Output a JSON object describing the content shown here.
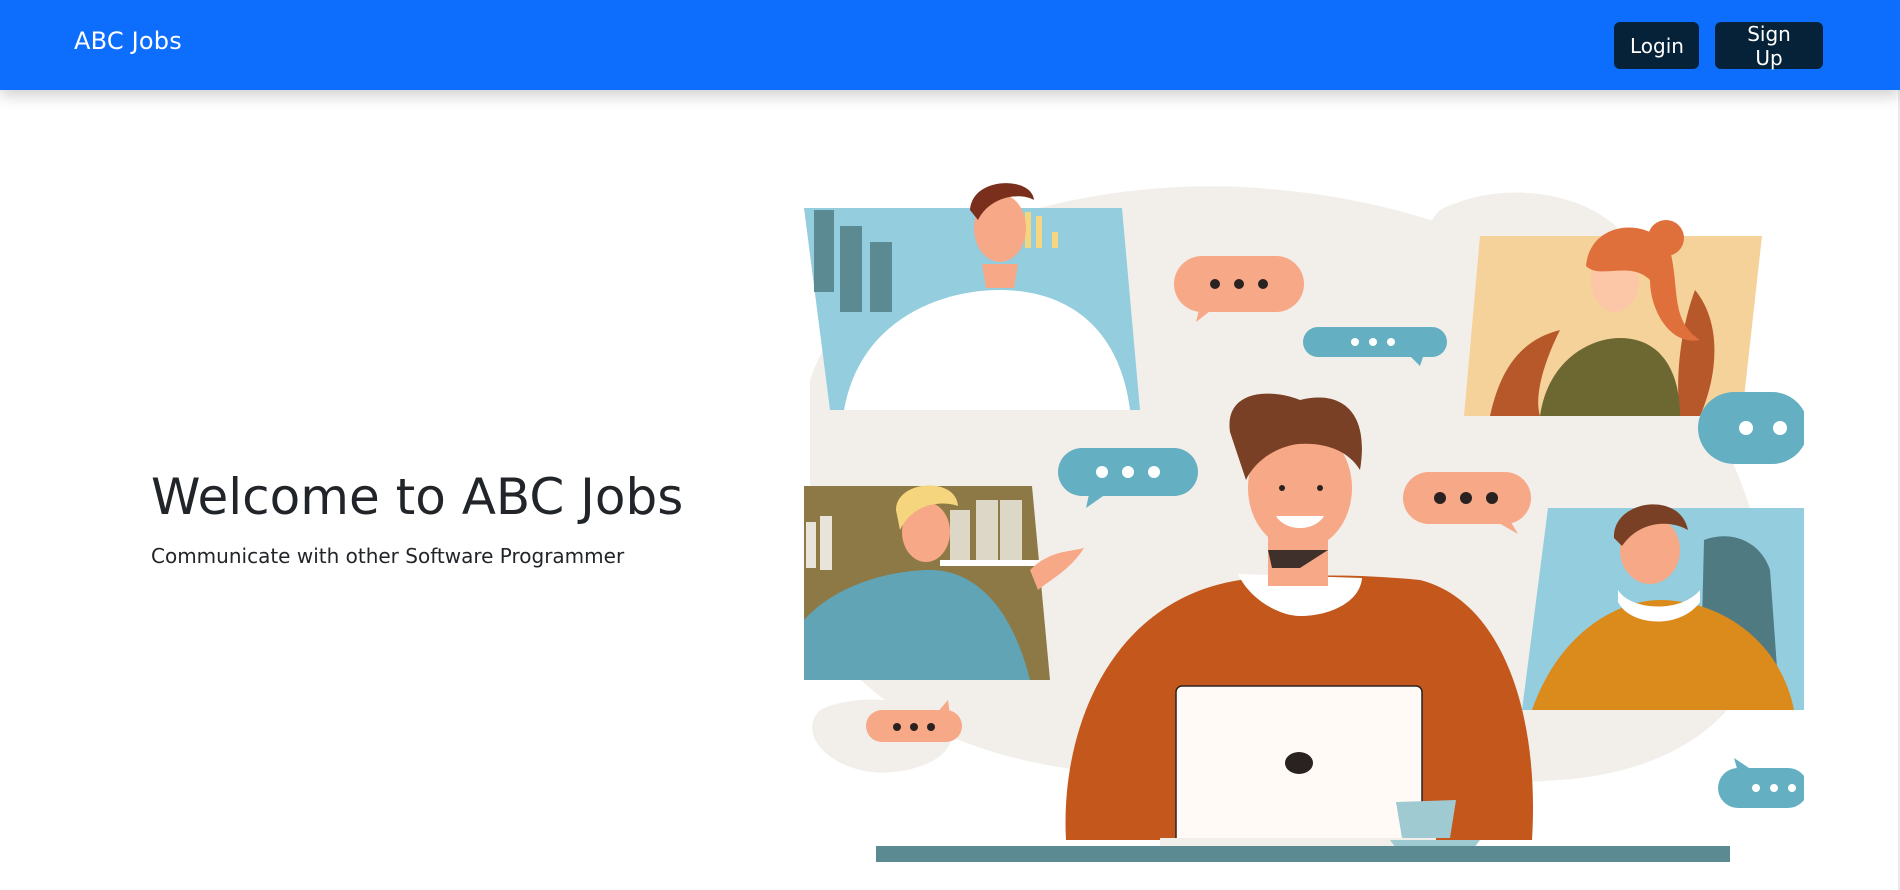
{
  "navbar": {
    "brand": "ABC Jobs",
    "login_label": "Login",
    "signup_label": "Sign Up"
  },
  "hero": {
    "title": "Welcome to ABC Jobs",
    "subtitle": "Communicate with other Software Programmer"
  },
  "illustration": {
    "description_icon": "video-call-illustration-icon"
  },
  "colors": {
    "primary": "#0d6efd",
    "button_dark": "#052238",
    "orange": "#c4581c",
    "teal_bubble": "#64b0c2",
    "peach_bubble": "#f7a886"
  }
}
